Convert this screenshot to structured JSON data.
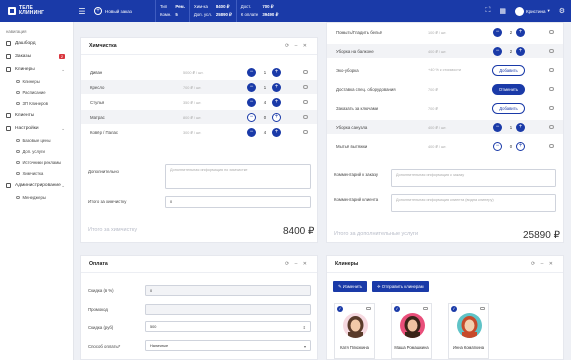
{
  "topbar": {
    "logo_line1": "ТЕЛЕ",
    "logo_line2": "КЛИНИНГ",
    "new_order": "Новый заказ",
    "stats": [
      {
        "k1": "Тип",
        "v1": "Рем.",
        "k2": "Комн.",
        "v2": "5"
      },
      {
        "k1": "Хим-ка",
        "v1": "8400 ₽",
        "k2": "Доп. усл.",
        "v2": "25890 ₽"
      },
      {
        "k1": "Дост.",
        "v1": "700 ₽",
        "k2": "К оплате",
        "v2": "39490 ₽"
      }
    ],
    "user_name": "Кристина"
  },
  "sidebar": {
    "section": "навигация",
    "items": [
      {
        "label": "Дашборд"
      },
      {
        "label": "Заказы",
        "badge": "2"
      },
      {
        "label": "Клинеры"
      },
      {
        "label": "Клиенты"
      },
      {
        "label": "Настройки"
      },
      {
        "label": "Администрирование"
      }
    ],
    "cleaners_sub": [
      "Клинеры",
      "Расписание",
      "ЗП Клинеров"
    ],
    "settings_sub": [
      "Базовые цены",
      "Доп. услуги",
      "Источники рекламы",
      "Химчистка"
    ],
    "admin_sub": [
      "Менеджеры"
    ]
  },
  "chem": {
    "title": "Химчистка",
    "rows": [
      {
        "name": "Диван",
        "price": "5000 ₽ / шт.",
        "qty": "1"
      },
      {
        "name": "Кресло",
        "price": "700 ₽ / шт.",
        "qty": "1"
      },
      {
        "name": "Стулья",
        "price": "350 ₽ / шт.",
        "qty": "4"
      },
      {
        "name": "Матрас",
        "price": "800 ₽ / шт.",
        "qty": "0"
      },
      {
        "name": "Ковёр / Палас",
        "price": "300 ₽ / шт.",
        "qty": "4"
      }
    ],
    "extra_label": "Дополнительно",
    "extra_placeholder": "Дополнительная информация по химчистке",
    "total_label_field": "Итого за химчистку",
    "total_field_value": "0",
    "total_caption": "Итого за химчистку",
    "total_value": "8400 ₽"
  },
  "extra": {
    "rows": [
      {
        "name": "Помыть/Гладить бельё",
        "price": "100 ₽ / шт.",
        "type": "stepper",
        "qty": "2"
      },
      {
        "name": "Уборка на балконе",
        "price": "400 ₽ / шт.",
        "type": "stepper",
        "qty": "2"
      },
      {
        "name": "Эко-уборка",
        "price": "+40 % к стоимости",
        "type": "add",
        "btn": "Добавить"
      },
      {
        "name": "Доставка спец. оборудования",
        "price": "700 ₽",
        "type": "cancel",
        "btn": "Отменить"
      },
      {
        "name": "Заказать за ключами",
        "price": "700 ₽",
        "type": "add",
        "btn": "Добавить"
      },
      {
        "name": "Уборка санузла",
        "price": "400 ₽ / шт.",
        "type": "stepper",
        "qty": "1"
      },
      {
        "name": "Мытьё вытяжки",
        "price": "400 ₽ / шт.",
        "type": "stepper_light",
        "qty": "0"
      }
    ],
    "comment_order_label": "Комментарий к заказу",
    "comment_order_placeholder": "Дополнительная информация к заказу",
    "comment_client_label": "Комментарий клиента",
    "comment_client_placeholder": "Дополнительная информация клиента (видна клинеру)",
    "total_caption": "Итого за дополнительные услуги",
    "total_value": "25890 ₽"
  },
  "payment": {
    "title": "Оплата",
    "discount_pct_label": "Скидка (в %)",
    "discount_pct_value": "0",
    "promo_label": "Промокод",
    "discount_rub_label": "Скидка (руб)",
    "discount_rub_value": "500",
    "method_label": "Способ оплаты*",
    "method_value": "Наличные"
  },
  "cleaners": {
    "title": "Клинеры",
    "edit_btn": "Изменить",
    "send_btn": "Отправить клинерам",
    "people": [
      {
        "name": "Катя Плюхкина"
      },
      {
        "name": "Маша Ромашкина"
      },
      {
        "name": "Инна Коматкина"
      }
    ]
  }
}
